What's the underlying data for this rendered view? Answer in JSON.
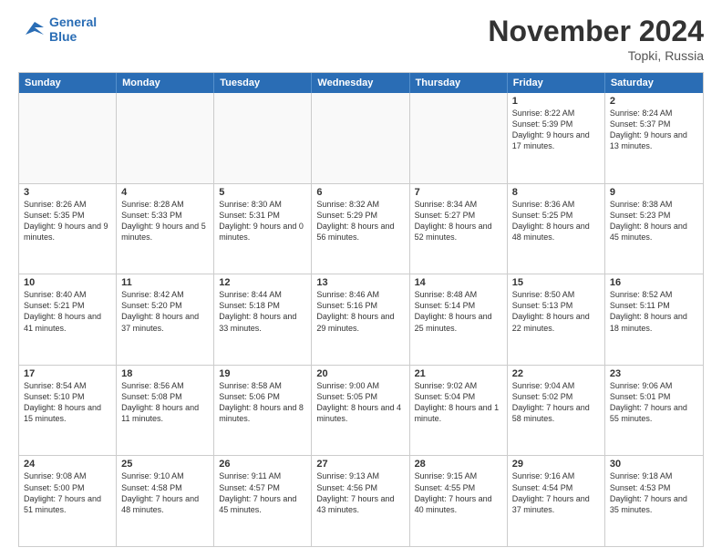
{
  "logo": {
    "line1": "General",
    "line2": "Blue"
  },
  "title": "November 2024",
  "location": "Topki, Russia",
  "header_days": [
    "Sunday",
    "Monday",
    "Tuesday",
    "Wednesday",
    "Thursday",
    "Friday",
    "Saturday"
  ],
  "weeks": [
    [
      {
        "day": "",
        "info": ""
      },
      {
        "day": "",
        "info": ""
      },
      {
        "day": "",
        "info": ""
      },
      {
        "day": "",
        "info": ""
      },
      {
        "day": "",
        "info": ""
      },
      {
        "day": "1",
        "info": "Sunrise: 8:22 AM\nSunset: 5:39 PM\nDaylight: 9 hours and 17 minutes."
      },
      {
        "day": "2",
        "info": "Sunrise: 8:24 AM\nSunset: 5:37 PM\nDaylight: 9 hours and 13 minutes."
      }
    ],
    [
      {
        "day": "3",
        "info": "Sunrise: 8:26 AM\nSunset: 5:35 PM\nDaylight: 9 hours and 9 minutes."
      },
      {
        "day": "4",
        "info": "Sunrise: 8:28 AM\nSunset: 5:33 PM\nDaylight: 9 hours and 5 minutes."
      },
      {
        "day": "5",
        "info": "Sunrise: 8:30 AM\nSunset: 5:31 PM\nDaylight: 9 hours and 0 minutes."
      },
      {
        "day": "6",
        "info": "Sunrise: 8:32 AM\nSunset: 5:29 PM\nDaylight: 8 hours and 56 minutes."
      },
      {
        "day": "7",
        "info": "Sunrise: 8:34 AM\nSunset: 5:27 PM\nDaylight: 8 hours and 52 minutes."
      },
      {
        "day": "8",
        "info": "Sunrise: 8:36 AM\nSunset: 5:25 PM\nDaylight: 8 hours and 48 minutes."
      },
      {
        "day": "9",
        "info": "Sunrise: 8:38 AM\nSunset: 5:23 PM\nDaylight: 8 hours and 45 minutes."
      }
    ],
    [
      {
        "day": "10",
        "info": "Sunrise: 8:40 AM\nSunset: 5:21 PM\nDaylight: 8 hours and 41 minutes."
      },
      {
        "day": "11",
        "info": "Sunrise: 8:42 AM\nSunset: 5:20 PM\nDaylight: 8 hours and 37 minutes."
      },
      {
        "day": "12",
        "info": "Sunrise: 8:44 AM\nSunset: 5:18 PM\nDaylight: 8 hours and 33 minutes."
      },
      {
        "day": "13",
        "info": "Sunrise: 8:46 AM\nSunset: 5:16 PM\nDaylight: 8 hours and 29 minutes."
      },
      {
        "day": "14",
        "info": "Sunrise: 8:48 AM\nSunset: 5:14 PM\nDaylight: 8 hours and 25 minutes."
      },
      {
        "day": "15",
        "info": "Sunrise: 8:50 AM\nSunset: 5:13 PM\nDaylight: 8 hours and 22 minutes."
      },
      {
        "day": "16",
        "info": "Sunrise: 8:52 AM\nSunset: 5:11 PM\nDaylight: 8 hours and 18 minutes."
      }
    ],
    [
      {
        "day": "17",
        "info": "Sunrise: 8:54 AM\nSunset: 5:10 PM\nDaylight: 8 hours and 15 minutes."
      },
      {
        "day": "18",
        "info": "Sunrise: 8:56 AM\nSunset: 5:08 PM\nDaylight: 8 hours and 11 minutes."
      },
      {
        "day": "19",
        "info": "Sunrise: 8:58 AM\nSunset: 5:06 PM\nDaylight: 8 hours and 8 minutes."
      },
      {
        "day": "20",
        "info": "Sunrise: 9:00 AM\nSunset: 5:05 PM\nDaylight: 8 hours and 4 minutes."
      },
      {
        "day": "21",
        "info": "Sunrise: 9:02 AM\nSunset: 5:04 PM\nDaylight: 8 hours and 1 minute."
      },
      {
        "day": "22",
        "info": "Sunrise: 9:04 AM\nSunset: 5:02 PM\nDaylight: 7 hours and 58 minutes."
      },
      {
        "day": "23",
        "info": "Sunrise: 9:06 AM\nSunset: 5:01 PM\nDaylight: 7 hours and 55 minutes."
      }
    ],
    [
      {
        "day": "24",
        "info": "Sunrise: 9:08 AM\nSunset: 5:00 PM\nDaylight: 7 hours and 51 minutes."
      },
      {
        "day": "25",
        "info": "Sunrise: 9:10 AM\nSunset: 4:58 PM\nDaylight: 7 hours and 48 minutes."
      },
      {
        "day": "26",
        "info": "Sunrise: 9:11 AM\nSunset: 4:57 PM\nDaylight: 7 hours and 45 minutes."
      },
      {
        "day": "27",
        "info": "Sunrise: 9:13 AM\nSunset: 4:56 PM\nDaylight: 7 hours and 43 minutes."
      },
      {
        "day": "28",
        "info": "Sunrise: 9:15 AM\nSunset: 4:55 PM\nDaylight: 7 hours and 40 minutes."
      },
      {
        "day": "29",
        "info": "Sunrise: 9:16 AM\nSunset: 4:54 PM\nDaylight: 7 hours and 37 minutes."
      },
      {
        "day": "30",
        "info": "Sunrise: 9:18 AM\nSunset: 4:53 PM\nDaylight: 7 hours and 35 minutes."
      }
    ]
  ]
}
